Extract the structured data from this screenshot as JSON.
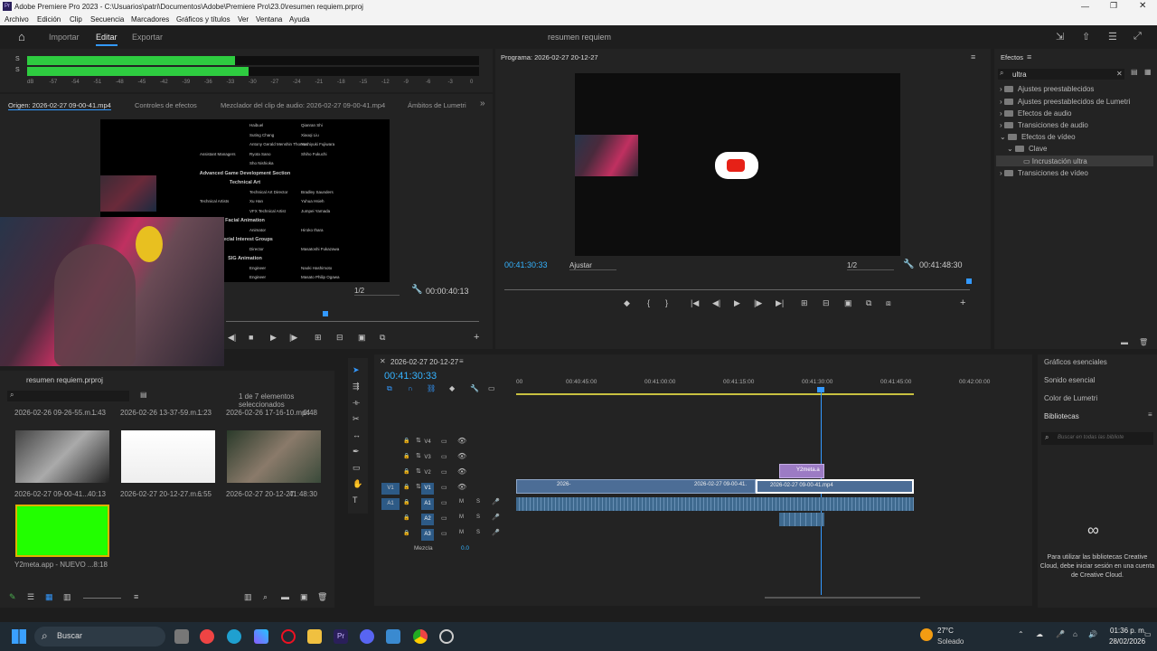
{
  "window": {
    "title": "Adobe Premiere Pro 2023 - C:\\Usuarios\\patri\\Documentos\\Adobe\\Premiere Pro\\23.0\\resumen requiem.prproj"
  },
  "menu": [
    "Archivo",
    "Edición",
    "Clip",
    "Secuencia",
    "Marcadores",
    "Gráficos y títulos",
    "Ver",
    "Ventana",
    "Ayuda"
  ],
  "workspace": {
    "tabs": [
      "Importar",
      "Editar",
      "Exportar"
    ],
    "project_title": "resumen requiem"
  },
  "audio_meter": {
    "scale": [
      "dB",
      "-57",
      "-54",
      "-51",
      "-48",
      "-45",
      "-42",
      "-39",
      "-36",
      "-33",
      "-30",
      "-27",
      "-24",
      "-21",
      "-18",
      "-15",
      "-12",
      "-9",
      "-6",
      "-3",
      "0"
    ],
    "levels": [
      0.44,
      0.46
    ]
  },
  "source": {
    "tabs": [
      "Origen: 2026-02-27 09-00-41.mp4",
      "Controles de efectos",
      "Mezclador del clip de audio: 2026-02-27 09-00-41.mp4",
      "Ámbitos de Lumetri"
    ],
    "zoom": "1/2",
    "timecode": "00:00:40:13",
    "credits": [
      [
        "Haibuel",
        "Qianran Shi"
      ],
      [
        "Suting Chang",
        "Xiaoqi Liu"
      ],
      [
        "Antony Gerald Menshin Thomas",
        "Yoshiyuki Fujiwara"
      ],
      [
        "Assistant Managers",
        "Ryota Sano",
        "Shiho Fukuchi"
      ],
      [
        "",
        "Sho Nishioka",
        ""
      ],
      [
        "Advanced Game Development Section"
      ],
      [
        "Technical Art"
      ],
      [
        "Technical Art Director",
        "Bradley Saunders"
      ],
      [
        "Technical Artists",
        "Xu Han",
        "Yuhua Hsieh"
      ],
      [
        "VFX Technical Artist",
        "Jumpei Yamada"
      ],
      [
        "Facial Animation"
      ],
      [
        "Animator",
        "Hiroko Ihara"
      ],
      [
        "Special Interest Groups"
      ],
      [
        "Director",
        "Masatoshi Fukazawa"
      ],
      [
        "SIG Animation"
      ],
      [
        "Engineer",
        "Naoki Hashimoto"
      ],
      [
        "Engineer",
        "Masato Philip Ogawa"
      ]
    ]
  },
  "program": {
    "title": "Programa: 2026-02-27 20-12-27",
    "timecode": "00:41:30:33",
    "fit": "Ajustar",
    "zoom": "1/2",
    "duration": "00:41:48:30"
  },
  "effects": {
    "title": "Efectos",
    "search": "ultra",
    "items": [
      "Ajustes preestablecidos",
      "Ajustes preestablecidos de Lumetri",
      "Efectos de audio",
      "Transiciones de audio",
      "Efectos de vídeo",
      "Clave",
      "Incrustación ultra",
      "Transiciones de vídeo"
    ]
  },
  "project": {
    "title": "resumen requiem.prproj",
    "selection": "1 de 7 elementos seleccionados",
    "items": [
      {
        "name": "2026-02-26 09-26-55.m...",
        "dur": "1:43"
      },
      {
        "name": "2026-02-26 13-37-59.m...",
        "dur": "1:23"
      },
      {
        "name": "2026-02-26 17-16-10.mp4",
        "dur": "0:48"
      },
      {
        "name": "2026-02-27 09-00-41...",
        "dur": "40:13"
      },
      {
        "name": "2026-02-27 20-12-27.m...",
        "dur": "6:55"
      },
      {
        "name": "2026-02-27 20-12-27",
        "dur": "41:48:30"
      },
      {
        "name": "Y2meta.app - NUEVO ...",
        "dur": "8:18"
      }
    ]
  },
  "timeline": {
    "title": "2026-02-27 20-12-27",
    "timecode": "00:41:30:33",
    "ruler": [
      "00",
      "00:40:45:00",
      "00:41:00:00",
      "00:41:15:00",
      "00:41:30:00",
      "00:41:45:00",
      "00:42:00:00"
    ],
    "vtracks": [
      "V4",
      "V3",
      "V2",
      "V1"
    ],
    "atracks": [
      "A1",
      "A2",
      "A3"
    ],
    "mix_label": "Mezcla",
    "mix_value": "0.0",
    "clips": {
      "v1a": "2026-",
      "v1b": "2026-02-27 09-00-41.",
      "v1c": "2026-02-27 09-00-41.mp4",
      "v2": "Y2meta.a"
    }
  },
  "right": {
    "items": [
      "Gráficos esenciales",
      "Sonido esencial",
      "Color de Lumetri",
      "Bibliotecas"
    ],
    "search_placeholder": "Buscar en todas las bibliote",
    "message": "Para utilizar las bibliotecas Creative Cloud, debe iniciar sesión en una cuenta de Creative Cloud."
  },
  "taskbar": {
    "search": "Buscar",
    "temp": "27°C",
    "weather": "Soleado",
    "time": "01:36 p. m.",
    "date": "28/02/2026"
  },
  "track_btn": {
    "lock": "🔒",
    "m": "M",
    "s": "S"
  }
}
